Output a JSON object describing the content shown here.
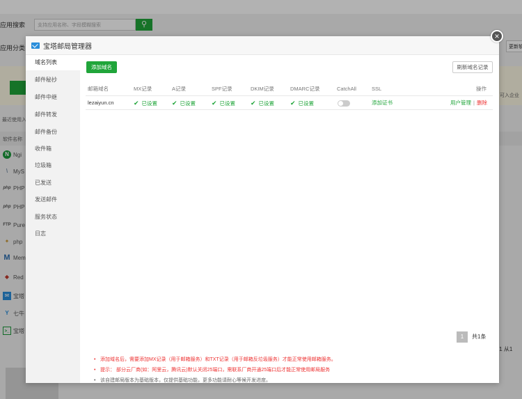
{
  "background": {
    "search_label": "应用搜索",
    "search_placeholder": "支持应用名称、字段模糊搜索",
    "category_label": "应用分类",
    "update_button": "更新软件",
    "right_text": "可入企业",
    "recent_label": "最近使用入",
    "table_head": "软件名称",
    "items": [
      {
        "icon": "N",
        "label": "Ngi"
      },
      {
        "icon": "\\",
        "label": "MyS"
      },
      {
        "icon": "php",
        "label": "PHP"
      },
      {
        "icon": "php",
        "label": "PHP"
      },
      {
        "icon": "FTP",
        "label": "Pure"
      },
      {
        "icon": "✦",
        "label": "php"
      },
      {
        "icon": "M",
        "label": "Mem"
      },
      {
        "icon": "◆",
        "label": "Red"
      },
      {
        "icon": "✉",
        "label": "宝塔"
      },
      {
        "icon": "Y",
        "label": "七牛"
      },
      {
        "icon": ">_",
        "label": "宝塔"
      }
    ],
    "pager_text": "/1  从1"
  },
  "modal": {
    "title": "宝塔邮局管理器",
    "close": "×",
    "sidebar": [
      "域名列表",
      "邮件秘抄",
      "邮件中继",
      "邮件转发",
      "邮件备份",
      "收件箱",
      "垃圾箱",
      "已发送",
      "发送邮件",
      "服务状态",
      "日志"
    ],
    "add_domain_button": "添加域名",
    "refresh_button": "刷新域名记录",
    "table": {
      "headers": [
        "邮箱域名",
        "MX记录",
        "A记录",
        "SPF记录",
        "DKIM记录",
        "DMARC记录",
        "CatchAll",
        "SSL",
        "操作"
      ],
      "rows": [
        {
          "domain": "lezaiyun.cn",
          "mx": "已设置",
          "a": "已设置",
          "spf": "已设置",
          "dkim": "已设置",
          "dmarc": "已设置",
          "catchall_on": false,
          "ssl": "添加证书",
          "action_manage": "用户管理",
          "action_delete": "删除"
        }
      ]
    },
    "pagination": {
      "page": "1",
      "total": "共1条"
    },
    "notes": [
      "添加域名后，需要添加MX记录（用于邮箱服务）和TXT记录（用于邮箱反垃圾服务）才能正常使用邮箱服务。",
      "提示：  部分云厂商(如：阿里云，腾讯云)默认关闭25端口，需联系厂商开通25端口后才能正常使用邮局服务",
      "该自建邮局版本为基础版本，仅提供基础功能，更多功能请耐心等候开发进度。"
    ]
  }
}
